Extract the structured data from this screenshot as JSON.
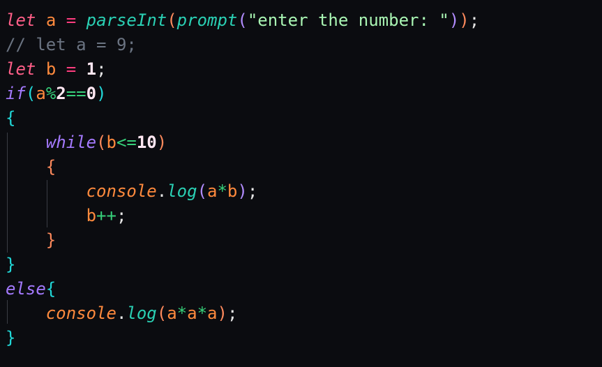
{
  "editor": {
    "lines": [
      {
        "tokens": [
          {
            "text": "let",
            "cls": "kw it"
          },
          {
            "text": " ",
            "cls": "punct"
          },
          {
            "text": "a",
            "cls": "var"
          },
          {
            "text": " ",
            "cls": "punct"
          },
          {
            "text": "=",
            "cls": "op"
          },
          {
            "text": " ",
            "cls": "punct"
          },
          {
            "text": "parseInt",
            "cls": "fn it"
          },
          {
            "text": "(",
            "cls": "paren"
          },
          {
            "text": "prompt",
            "cls": "fn it"
          },
          {
            "text": "(",
            "cls": "paren2"
          },
          {
            "text": "\"enter the number: \"",
            "cls": "str"
          },
          {
            "text": ")",
            "cls": "paren2"
          },
          {
            "text": ")",
            "cls": "paren"
          },
          {
            "text": ";",
            "cls": "punct"
          }
        ]
      },
      {
        "tokens": [
          {
            "text": "// let a = 9;",
            "cls": "cmt"
          }
        ]
      },
      {
        "tokens": [
          {
            "text": "let",
            "cls": "kw it"
          },
          {
            "text": " ",
            "cls": "punct"
          },
          {
            "text": "b",
            "cls": "var"
          },
          {
            "text": " ",
            "cls": "punct"
          },
          {
            "text": "=",
            "cls": "op"
          },
          {
            "text": " ",
            "cls": "punct"
          },
          {
            "text": "1",
            "cls": "num"
          },
          {
            "text": ";",
            "cls": "punct"
          }
        ]
      },
      {
        "tokens": [
          {
            "text": "if",
            "cls": "kw2 it"
          },
          {
            "text": "(",
            "cls": "brace"
          },
          {
            "text": "a",
            "cls": "var"
          },
          {
            "text": "%",
            "cls": "op2"
          },
          {
            "text": "2",
            "cls": "num"
          },
          {
            "text": "==",
            "cls": "op2"
          },
          {
            "text": "0",
            "cls": "num"
          },
          {
            "text": ")",
            "cls": "brace"
          }
        ]
      },
      {
        "tokens": [
          {
            "text": "{",
            "cls": "brace"
          }
        ]
      },
      {
        "tokens": [
          {
            "text": "    ",
            "cls": "punct"
          },
          {
            "text": "while",
            "cls": "kw2 it"
          },
          {
            "text": "(",
            "cls": "paren"
          },
          {
            "text": "b",
            "cls": "var"
          },
          {
            "text": "<=",
            "cls": "op2"
          },
          {
            "text": "10",
            "cls": "num"
          },
          {
            "text": ")",
            "cls": "paren"
          }
        ]
      },
      {
        "tokens": [
          {
            "text": "    ",
            "cls": "punct"
          },
          {
            "text": "{",
            "cls": "paren"
          }
        ]
      },
      {
        "tokens": [
          {
            "text": "        ",
            "cls": "punct"
          },
          {
            "text": "console",
            "cls": "var it"
          },
          {
            "text": ".",
            "cls": "punct"
          },
          {
            "text": "log",
            "cls": "method it"
          },
          {
            "text": "(",
            "cls": "paren2"
          },
          {
            "text": "a",
            "cls": "var"
          },
          {
            "text": "*",
            "cls": "op2"
          },
          {
            "text": "b",
            "cls": "var"
          },
          {
            "text": ")",
            "cls": "paren2"
          },
          {
            "text": ";",
            "cls": "punct"
          }
        ]
      },
      {
        "tokens": [
          {
            "text": "        ",
            "cls": "punct"
          },
          {
            "text": "b",
            "cls": "var"
          },
          {
            "text": "++",
            "cls": "op2"
          },
          {
            "text": ";",
            "cls": "punct"
          }
        ]
      },
      {
        "tokens": [
          {
            "text": "    ",
            "cls": "punct"
          },
          {
            "text": "}",
            "cls": "paren"
          }
        ]
      },
      {
        "tokens": [
          {
            "text": "}",
            "cls": "brace"
          }
        ]
      },
      {
        "tokens": [
          {
            "text": "else",
            "cls": "kw2 it"
          },
          {
            "text": "{",
            "cls": "brace"
          }
        ]
      },
      {
        "tokens": [
          {
            "text": "    ",
            "cls": "punct"
          },
          {
            "text": "console",
            "cls": "var it"
          },
          {
            "text": ".",
            "cls": "punct"
          },
          {
            "text": "log",
            "cls": "method it"
          },
          {
            "text": "(",
            "cls": "paren"
          },
          {
            "text": "a",
            "cls": "var"
          },
          {
            "text": "*",
            "cls": "op2"
          },
          {
            "text": "a",
            "cls": "var"
          },
          {
            "text": "*",
            "cls": "op2"
          },
          {
            "text": "a",
            "cls": "var"
          },
          {
            "text": ")",
            "cls": "paren"
          },
          {
            "text": ";",
            "cls": "punct"
          }
        ]
      },
      {
        "tokens": [
          {
            "text": "}",
            "cls": "brace"
          }
        ]
      }
    ]
  }
}
